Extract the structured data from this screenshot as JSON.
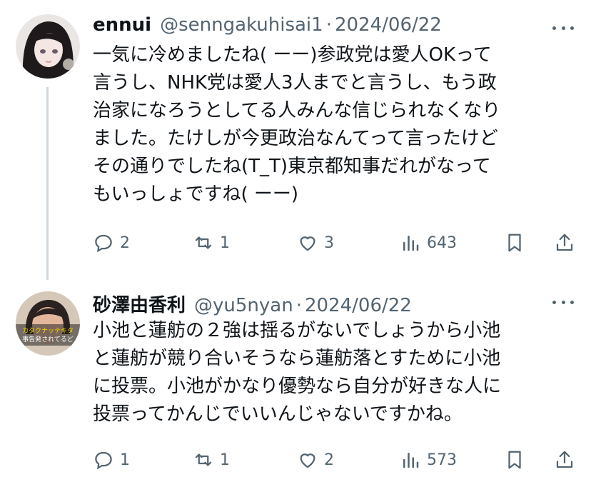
{
  "tweets": [
    {
      "display_name": "ennui",
      "handle": "@senngakuhisai1",
      "separator": "·",
      "date": "2024/06/22",
      "text": "一気に冷めましたね( ーー)参政党は愛人OKって\n言うし、NHK党は愛人3人までと言うし、もう政\n治家になろうとしてる人みんな信じられなくなり\nました。たけしが今更政治なんてって言ったけど\nその通りでしたね(T_T)東京都知事だれがなって\nもいっしょですね( ーー)",
      "replies": "2",
      "retweets": "1",
      "likes": "3",
      "views": "643",
      "avatar_icon": "anime-girl-avatar"
    },
    {
      "display_name": "砂澤由香利",
      "handle": "@yu5nyan",
      "separator": "·",
      "date": "2024/06/22",
      "text": "小池と蓮舫の２強は揺るがないでしょうから小池\nと蓮舫が競り合いそうなら蓮舫落とすために小池\nに投票。小池がかなり優勢なら自分が好きな人に\n投票ってかんじでいいんじゃないですかね。",
      "replies": "1",
      "retweets": "1",
      "likes": "2",
      "views": "573",
      "avatar_icon": "woman-photo-avatar",
      "avatar_caption": "カタクナッテキタ事告発されてるど"
    }
  ],
  "colors": {
    "text": "#0f1419",
    "muted": "#536471",
    "thread_line": "#cfd9de",
    "background": "#ffffff"
  },
  "icons": [
    "reply-icon",
    "retweet-icon",
    "like-icon",
    "views-icon",
    "bookmark-icon",
    "share-icon",
    "more-icon"
  ]
}
